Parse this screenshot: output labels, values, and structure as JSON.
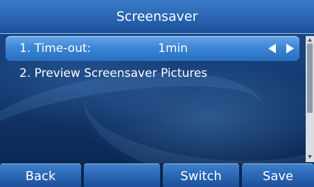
{
  "title": "Screensaver",
  "menu": {
    "items": [
      {
        "label": "1. Time-out:",
        "value": "1min"
      },
      {
        "label": "2. Preview Screensaver Pictures"
      }
    ]
  },
  "softkeys": [
    "Back",
    "",
    "Switch",
    "Save"
  ],
  "colors": {
    "accent": "#2a6fc0",
    "title_bar": "#2a66b4",
    "background": "#163f77"
  },
  "icons": [
    "arrow-left-icon",
    "arrow-right-icon",
    "scroll-up-icon",
    "scroll-down-icon"
  ]
}
